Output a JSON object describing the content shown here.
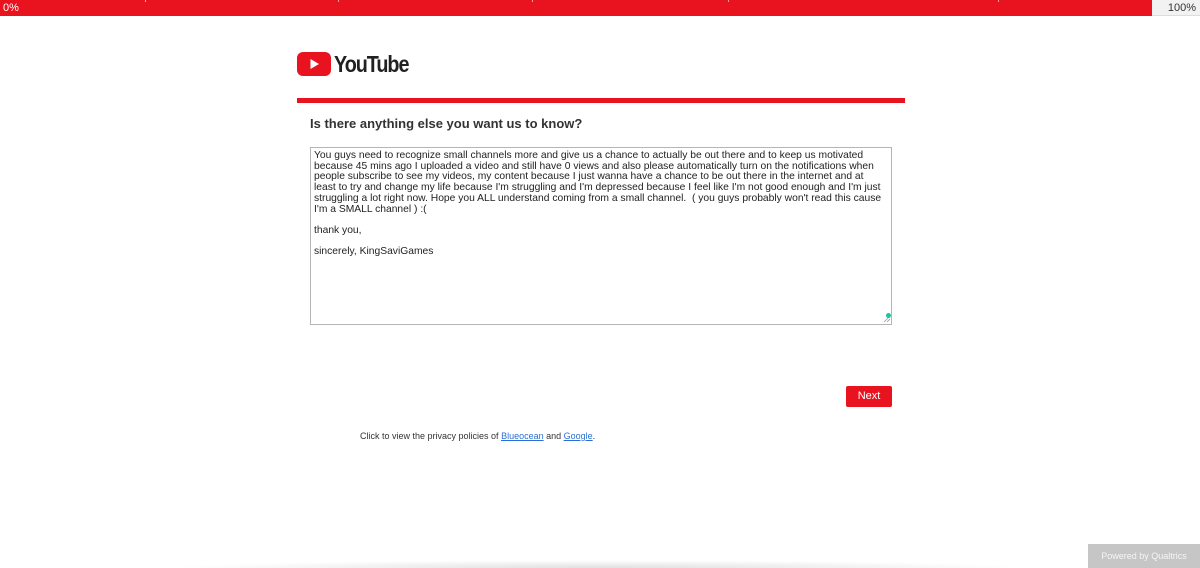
{
  "progress": {
    "start_label": "0%",
    "end_label": "100%",
    "fraction": 0.96
  },
  "logo": {
    "text": "YouTube",
    "icon": "youtube-play-icon",
    "brand_color": "#e8131f"
  },
  "question": {
    "text": "Is there anything else you want us to know?"
  },
  "answer": {
    "value": "You guys need to recognize small channels more and give us a chance to actually be out there and to keep us motivated because 45 mins ago I uploaded a video and still have 0 views and also please automatically turn on the notifications when people subscribe to see my videos, my content because I just wanna have a chance to be out there in the internet and at least to try and change my life because I'm struggling and I'm depressed because I feel like I'm not good enough and I'm just struggling a lot right now. Hope you ALL understand coming from a small channel.  ( you guys probably won't read this cause I'm a SMALL channel ) :(\n\nthank you,\n\nsincerely, KingSaviGames"
  },
  "buttons": {
    "next_label": "Next"
  },
  "privacy": {
    "prefix": "Click to view the privacy policies of ",
    "link1": "Blueocean",
    "middle": " and ",
    "link2": "Google",
    "suffix": "."
  },
  "footer": {
    "powered_by": "Powered by Qualtrics"
  }
}
